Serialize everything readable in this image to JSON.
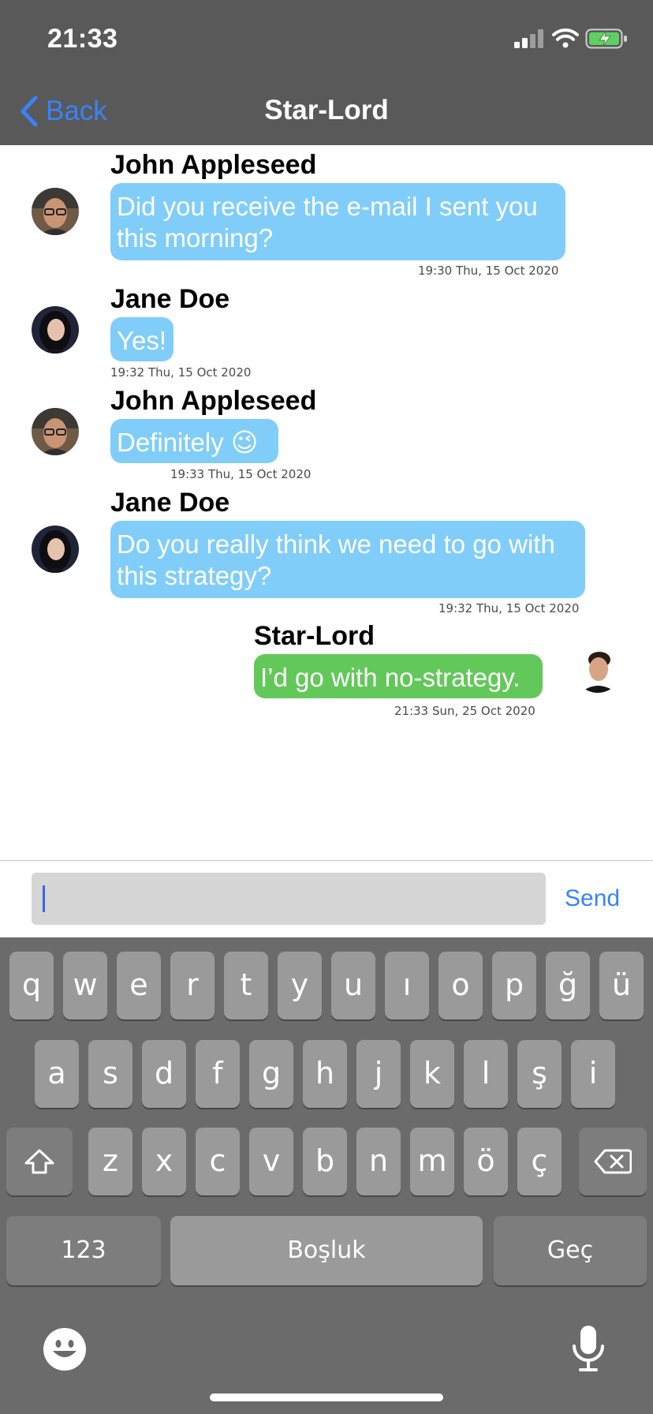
{
  "status_bar": {
    "time": "21:33"
  },
  "nav": {
    "back_label": "Back",
    "title": "Star-Lord"
  },
  "messages": [
    {
      "sender": "John Appleseed",
      "lines": [
        "Did you receive the e-mail I sent you",
        "this morning?"
      ],
      "timestamp": "19:30 Thu, 15 Oct 2020",
      "direction": "incoming"
    },
    {
      "sender": "Jane Doe",
      "lines": [
        "Yes!"
      ],
      "timestamp": "19:32 Thu, 15 Oct 2020",
      "direction": "incoming"
    },
    {
      "sender": "John Appleseed",
      "lines": [
        "Definitely 😉"
      ],
      "timestamp": "19:33 Thu, 15 Oct 2020",
      "direction": "incoming"
    },
    {
      "sender": "Jane Doe",
      "lines": [
        "Do you really think we need to go with",
        "this strategy?"
      ],
      "timestamp": "19:32 Thu, 15 Oct 2020",
      "direction": "incoming"
    },
    {
      "sender": "Star-Lord",
      "lines": [
        "I’d go with no-strategy."
      ],
      "timestamp": "21:33 Sun, 25 Oct 2020",
      "direction": "outgoing"
    }
  ],
  "composer": {
    "value": "",
    "send_label": "Send"
  },
  "keyboard": {
    "row1": [
      "q",
      "w",
      "e",
      "r",
      "t",
      "y",
      "u",
      "ı",
      "o",
      "p",
      "ğ",
      "ü"
    ],
    "row2": [
      "a",
      "s",
      "d",
      "f",
      "g",
      "h",
      "j",
      "k",
      "l",
      "ş",
      "i"
    ],
    "row3": [
      "z",
      "x",
      "c",
      "v",
      "b",
      "n",
      "m",
      "ö",
      "ç"
    ],
    "numbers_label": "123",
    "space_label": "Boşluk",
    "return_label": "Geç"
  },
  "colors": {
    "nav_background": "#595959",
    "incoming_bubble": "#80cdf9",
    "outgoing_bubble": "#63c85a",
    "accent": "#3a82f7",
    "keyboard_background": "#6b6b6b"
  },
  "icons": [
    "cellular-signal-icon",
    "wifi-icon",
    "battery-charging-icon",
    "chevron-left-icon",
    "shift-icon",
    "delete-icon",
    "emoji-icon",
    "microphone-icon"
  ]
}
